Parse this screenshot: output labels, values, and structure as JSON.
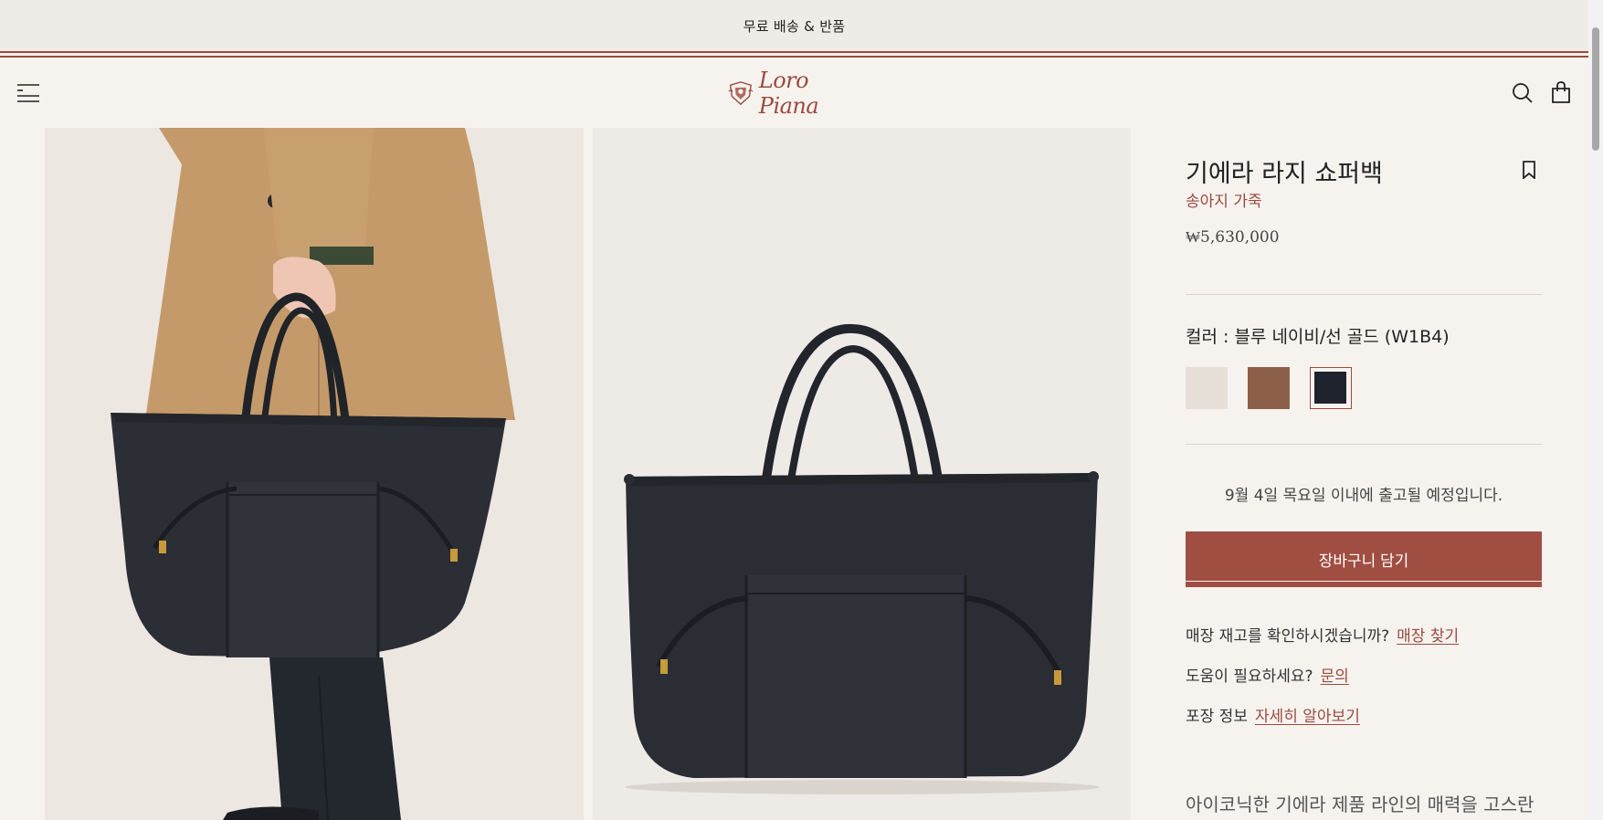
{
  "promo": {
    "text": "무료 배송 & 반품"
  },
  "header": {
    "menu_icon": "hamburger-menu-icon",
    "logo_text": "Loro Piana",
    "search_icon": "search-icon",
    "bag_icon": "shopping-bag-icon"
  },
  "product": {
    "title": "기에라 라지 쇼퍼백",
    "material": "송아지 가죽",
    "price": "₩5,630,000",
    "color_label": "컬러 : 블루 네이비/선 골드 (W1B4)",
    "swatches": [
      {
        "name": "cream",
        "color": "#e6e0d8"
      },
      {
        "name": "brown",
        "color": "#8c6048"
      },
      {
        "name": "navy",
        "color": "#1e222c",
        "selected": true
      }
    ],
    "shipping": "9월 4일 목요일 이내에 출고될 예정입니다.",
    "add_to_cart": "장바구니 담기",
    "store_question": "매장 재고를 확인하시겠습니까?",
    "store_link": "매장 찾기",
    "help_question": "도움이 필요하세요?",
    "help_link": "문의",
    "packaging_question": "포장 정보",
    "packaging_link": "자세히 알아보기",
    "description_partial": "아이코닉한 기에라 제품 라인의 매력을 고스란"
  },
  "colors": {
    "accent": "#9c4a3e",
    "button": "#a04e42",
    "background": "#f6f3ef",
    "promo_bg": "#efebe6"
  }
}
